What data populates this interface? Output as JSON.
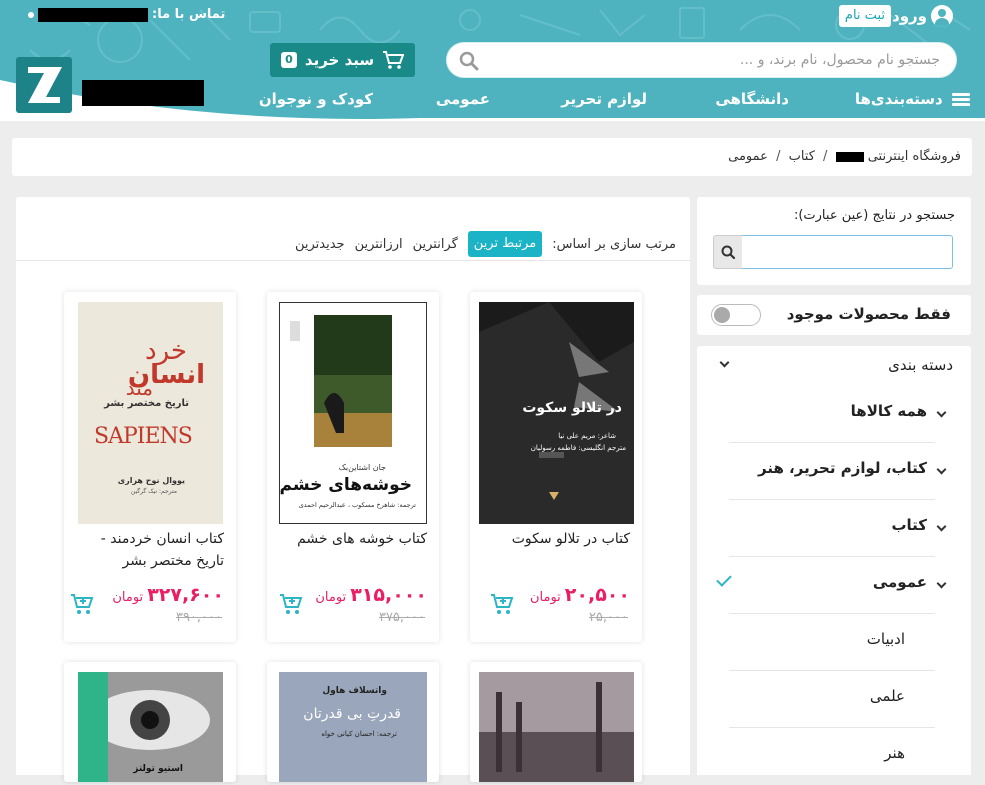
{
  "header": {
    "contact_label": "تماس با ما:",
    "login_label": "ورود",
    "register_label": "ثبت نام",
    "search_placeholder": "جستجو نام محصول، نام برند، و ...",
    "cart_label": "سبد خرید",
    "cart_count": "0",
    "nav": [
      "دسته‌بندی‌ها",
      "دانشگاهی",
      "لوازم تحریر",
      "عمومی",
      "کودک و نوجوان"
    ]
  },
  "breadcrumb": {
    "home": "فروشگاه اینترنتی",
    "items": [
      "کتاب",
      "عمومی"
    ],
    "sep": "/"
  },
  "sidebar": {
    "search_label": "جستجو در نتایج (عین عبارت):",
    "stock_label": "فقط محصولات موجود",
    "category_title": "دسته بندی",
    "categories": [
      "همه کالاها",
      "کتاب، لوازم تحریر، هنر",
      "کتاب",
      "عمومی",
      "ادبیات",
      "علمی",
      "هنر"
    ]
  },
  "sort": {
    "label": "مرتب سازی بر اساس:",
    "options": [
      "مرتبط ترین",
      "گرانترین",
      "ارزانترین",
      "جدیدترین"
    ]
  },
  "products": [
    {
      "title": "کتاب در تلالو سکوت",
      "price": "۲۰,۵۰۰",
      "currency": "تومان",
      "old_price": "۲۵,۰۰۰",
      "cover_title": "در تلالو سکوت",
      "cover_line1": "شاعر: مریم علی نیا",
      "cover_line2": "مترجم انگلیسی: فاطمه رسولیان"
    },
    {
      "title": "کتاب خوشه های خشم",
      "price": "۳۱۵,۰۰۰",
      "currency": "تومان",
      "old_price": "۳۷۵,۰۰۰",
      "cover_author": "جان اشتاین‌بک",
      "cover_title": "خوشه‌های خشم",
      "cover_line1": "ترجمه: شاهرخ مسکوب ، عبدالرحیم احمدی"
    },
    {
      "title": "کتاب انسان خردمند - تاریخ مختصر بشر",
      "price": "۳۲۷,۶۰۰",
      "currency": "تومان",
      "old_price": "۳۹۰,۰۰۰",
      "cover_top": "خرد",
      "cover_main": "انسان",
      "cover_mid": "مند",
      "cover_sub": "تاریخ مختصر بشر",
      "cover_en": "SAPIENS",
      "cover_author": "یووال نوح هراری",
      "cover_line1": "مترجم: نیک گرگین"
    },
    {
      "title": "",
      "cover_title": ""
    },
    {
      "title": "",
      "cover_author": "واتسلاف هاول",
      "cover_title": "قدرتِ بی قدرتان",
      "cover_line1": "ترجمه: احسان کیانی خواه"
    },
    {
      "title": "",
      "cover_author": "استیو تولتز"
    }
  ],
  "colors": {
    "teal": "#4fb3bf",
    "dark_teal": "#1a8a88",
    "accent": "#1bb3c6",
    "price": "#e91e63"
  }
}
